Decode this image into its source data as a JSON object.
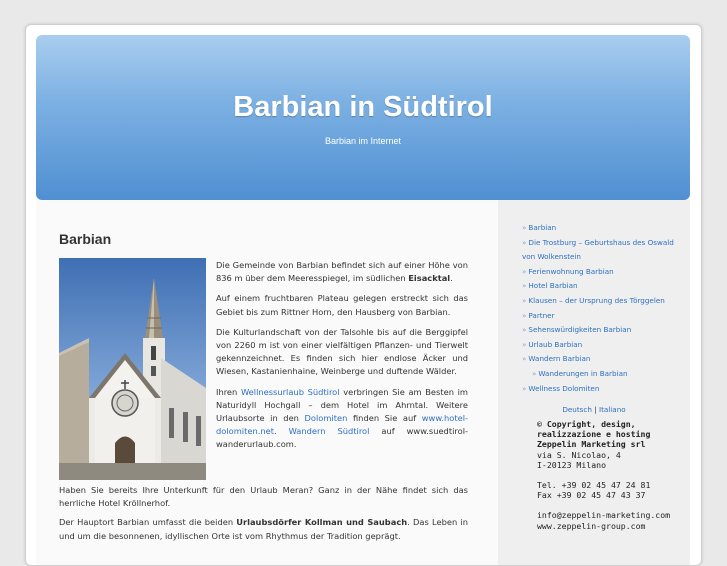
{
  "header": {
    "title": "Barbian in Südtirol",
    "subtitle": "Barbian im Internet"
  },
  "main": {
    "title": "Barbian",
    "image_alt": "church-photo",
    "paragraphs": [
      {
        "pre": "Die Gemeinde von Barbian befindet sich auf einer Höhe von 836 m über dem Meeresspiegel, im südlichen ",
        "strong": "Eisacktal",
        "post": "."
      },
      {
        "text": "Auf einem fruchtbaren Plateau gelegen erstreckt sich das Gebiet bis zum Rittner Horn, den Hausberg von Barbian."
      },
      {
        "text": "Die Kulturlandschaft von der Talsohle bis auf die Berggipfel von 2260 m ist von einer vielfältigen Pflanzen- und Tierwelt gekennzeichnet. Es finden sich hier endlose Äcker und Wiesen, Kastanienhaine, Weinberge und duftende Wälder."
      },
      {
        "p1": "Ihren ",
        "link1": "Wellnessurlaub Südtirol",
        "p2": " verbringen Sie am Besten im Naturidyll Hochgall – dem Hotel im Ahrntal. Weitere Urlaubsorte in den ",
        "link2": "Dolomiten",
        "p3": " finden Sie auf ",
        "link3": "www.hotel-dolomiten.net",
        "p4": ". ",
        "link4": "Wandern Südtirol",
        "p5": " auf www.suedtirol-wanderurlaub.com."
      },
      {
        "text": "Haben Sie bereits Ihre Unterkunft für den Urlaub Meran? Ganz in der Nähe findet sich das herrliche Hotel Kröllnerhof."
      },
      {
        "pre": "Der Hauptort Barbian umfasst die beiden ",
        "strong": "Urlaubsdörfer Kollman und Saubach",
        "post": ". Das Leben in und um die besonnenen, idyllischen Orte ist vom Rhythmus der Tradition geprägt."
      }
    ]
  },
  "sidebar": {
    "nav": [
      {
        "label": "Barbian",
        "sub": false
      },
      {
        "label": "Die Trostburg – Geburtshaus des Oswald von Wolkenstein",
        "sub": false
      },
      {
        "label": "Ferienwohnung Barbian",
        "sub": false
      },
      {
        "label": "Hotel Barbian",
        "sub": false
      },
      {
        "label": "Klausen – der Ursprung des Törggelen",
        "sub": false
      },
      {
        "label": "Partner",
        "sub": false
      },
      {
        "label": "Sehenswürdigkeiten Barbian",
        "sub": false
      },
      {
        "label": "Urlaub Barbian",
        "sub": false
      },
      {
        "label": "Wandern Barbian",
        "sub": false
      },
      {
        "label": "Wanderungen in Barbian",
        "sub": true
      },
      {
        "label": "Wellness Dolomiten",
        "sub": false
      }
    ],
    "lang": {
      "de": "Deutsch",
      "sep": "|",
      "it": "Italiano"
    },
    "company": {
      "copyright": "© Copyright, design, realizzazione e hosting Zeppelin Marketing srl",
      "address1": "via S. Nicolao, 4",
      "address2": "I-20123 Milano",
      "tel": "Tel. +39 02 45 47 24 81",
      "fax": "Fax +39 02 45 47 43 37",
      "email": "info@zeppelin-marketing.com",
      "web": "www.zeppelin-group.com"
    }
  },
  "colors": {
    "header_top": "#a9cdee",
    "header_bottom": "#4f8fd2",
    "link": "#2d6fc1"
  }
}
